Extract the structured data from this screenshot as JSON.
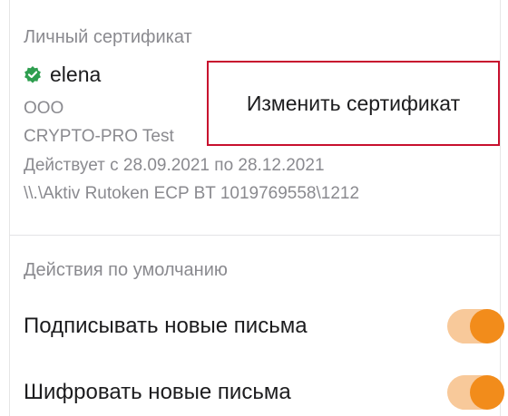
{
  "certificate_section": {
    "heading": "Личный сертификат",
    "name": "elena",
    "verified_icon": "check-badge-icon",
    "organization": "ООО",
    "issuer": "CRYPTO-PRO Test",
    "validity": "Действует с 28.09.2021 по 28.12.2021",
    "container_path": "\\\\.\\Aktiv Rutoken ECP BT 1019769558\\1212",
    "change_button_label": "Изменить сертификат"
  },
  "defaults_section": {
    "heading": "Действия по умолчанию",
    "settings": [
      {
        "label": "Подписывать новые письма",
        "enabled": true
      },
      {
        "label": "Шифровать новые письма",
        "enabled": true
      }
    ]
  },
  "colors": {
    "accent": "#f28c1b",
    "accent_track": "#f8c99a",
    "verified_green": "#2e9e4f",
    "highlight_border": "#c8102e",
    "secondary_text": "#8a8a8f",
    "primary_text": "#1c1c1e"
  }
}
